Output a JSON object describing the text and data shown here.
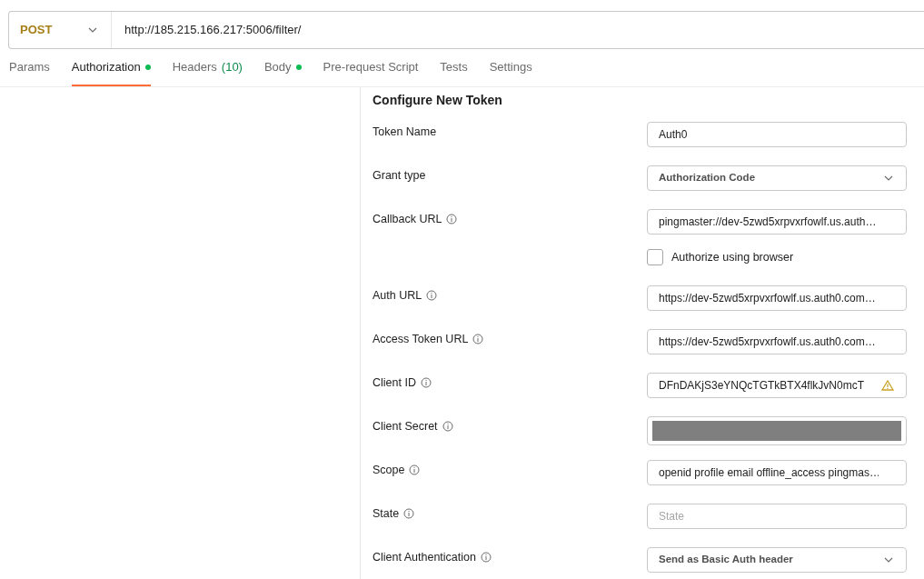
{
  "request": {
    "method": "POST",
    "url": "http://185.215.166.217:5006/filter/"
  },
  "tabs": [
    {
      "label": "Params",
      "selected": false,
      "dot": false
    },
    {
      "label": "Authorization",
      "selected": true,
      "dot": true
    },
    {
      "label": "Headers",
      "count": "(10)",
      "selected": false,
      "dot": false
    },
    {
      "label": "Body",
      "selected": false,
      "dot": true
    },
    {
      "label": "Pre-request Script",
      "selected": false,
      "dot": false
    },
    {
      "label": "Tests",
      "selected": false,
      "dot": false
    },
    {
      "label": "Settings",
      "selected": false,
      "dot": false
    }
  ],
  "section_title": "Configure New Token",
  "fields": [
    {
      "kind": "text",
      "label": "Token Name",
      "info": false,
      "value": "Auth0"
    },
    {
      "kind": "select",
      "label": "Grant type",
      "info": false,
      "value": "Authorization Code"
    },
    {
      "kind": "text",
      "label": "Callback URL",
      "info": true,
      "value": "pingmaster://dev-5zwd5xrpvxrfowlf.us.auth…"
    },
    {
      "kind": "checkbox",
      "label": "Authorize using browser",
      "checked": false
    },
    {
      "kind": "text",
      "label": "Auth URL",
      "info": true,
      "value": "https://dev-5zwd5xrpvxrfowlf.us.auth0.com…"
    },
    {
      "kind": "text",
      "label": "Access Token URL",
      "info": true,
      "value": "https://dev-5zwd5xrpvxrfowlf.us.auth0.com…"
    },
    {
      "kind": "text",
      "label": "Client ID",
      "info": true,
      "value": "DFnDAKjS3eYNQcTGTkBTX4flkJvN0mcT",
      "warning": true
    },
    {
      "kind": "masked",
      "label": "Client Secret",
      "info": true
    },
    {
      "kind": "text",
      "label": "Scope",
      "info": true,
      "value": "openid profile email offline_access pingmas…"
    },
    {
      "kind": "text",
      "label": "State",
      "info": true,
      "placeholder": "State"
    },
    {
      "kind": "select",
      "label": "Client Authentication",
      "info": true,
      "value": "Send as Basic Auth header"
    }
  ]
}
